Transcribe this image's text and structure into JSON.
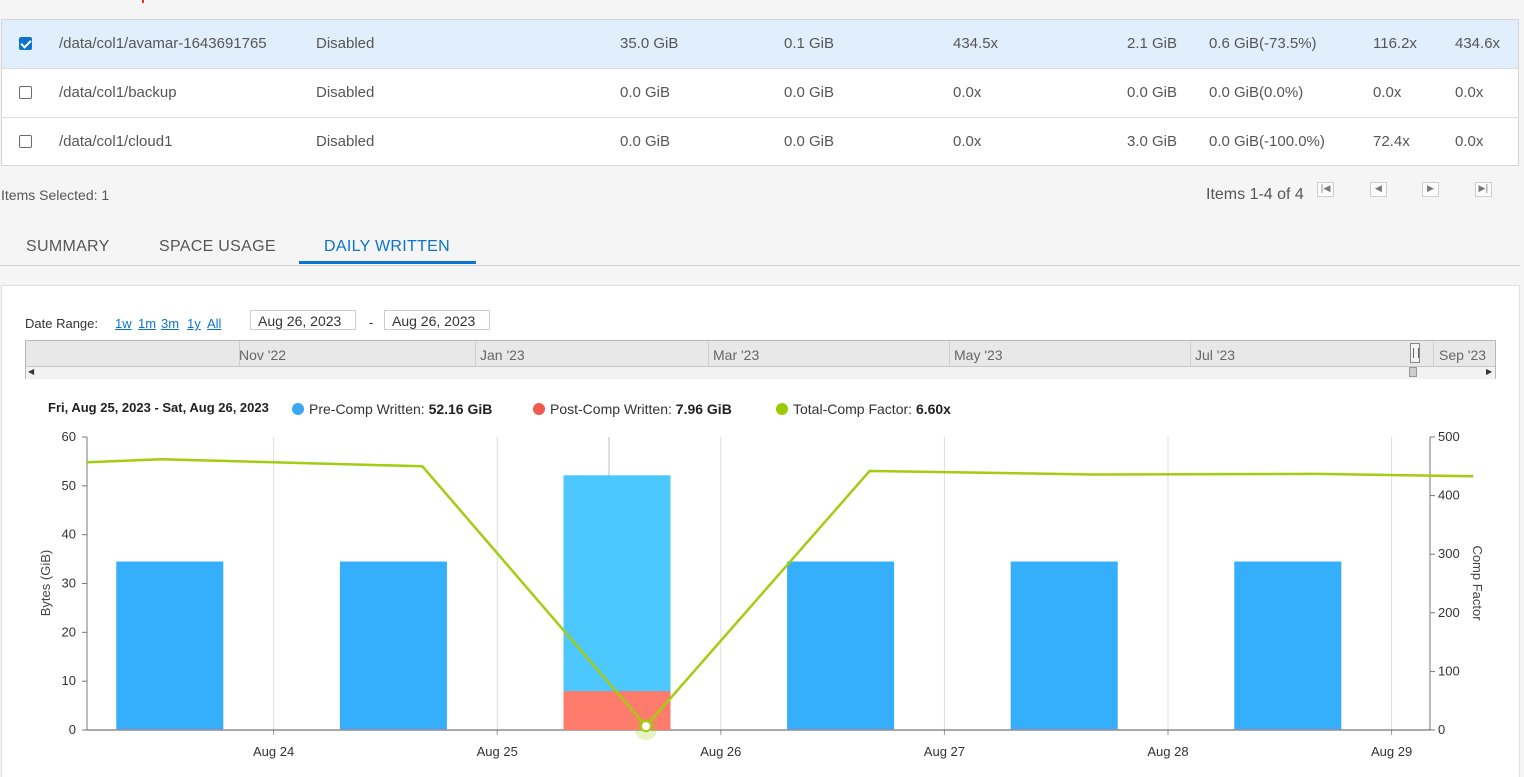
{
  "table": {
    "rows": [
      {
        "selected": true,
        "path": "/data/col1/avamar-1643691765",
        "status": "Disabled",
        "c3": "35.0 GiB",
        "c4": "0.1 GiB",
        "c5": "434.5x",
        "c6": "2.1 GiB",
        "c7": "0.6 GiB(-73.5%)",
        "c8": "116.2x",
        "c9": "434.6x"
      },
      {
        "selected": false,
        "path": "/data/col1/backup",
        "status": "Disabled",
        "c3": "0.0 GiB",
        "c4": "0.0 GiB",
        "c5": "0.0x",
        "c6": "0.0 GiB",
        "c7": "0.0 GiB(0.0%)",
        "c8": "0.0x",
        "c9": "0.0x"
      },
      {
        "selected": false,
        "path": "/data/col1/cloud1",
        "status": "Disabled",
        "c3": "0.0 GiB",
        "c4": "0.0 GiB",
        "c5": "0.0x",
        "c6": "3.0 GiB",
        "c7": "0.0 GiB(-100.0%)",
        "c8": "72.4x",
        "c9": "0.0x"
      }
    ]
  },
  "footer": {
    "items_selected": "Items Selected: 1",
    "items_count": "Items 1-4 of 4"
  },
  "tabs": [
    "SUMMARY",
    "SPACE USAGE",
    "DAILY WRITTEN"
  ],
  "active_tab": "DAILY WRITTEN",
  "date_range": {
    "label": "Date Range:",
    "presets": [
      "1w",
      "1m",
      "3m",
      "1y",
      "All"
    ],
    "from": "Aug 26, 2023",
    "separator": "-",
    "to": "Aug 26, 2023"
  },
  "navigator": {
    "months": [
      "Nov '22",
      "Jan '23",
      "Mar '23",
      "May '23",
      "Jul '23",
      "Sep '23"
    ]
  },
  "tooltip": {
    "period": "Fri, Aug 25, 2023 - Sat, Aug 26, 2023",
    "items": [
      {
        "label": "Pre-Comp Written:",
        "value": "52.16 GiB",
        "color": "#3aa8f5"
      },
      {
        "label": "Post-Comp Written:",
        "value": "7.96 GiB",
        "color": "#f0594d"
      },
      {
        "label": "Total-Comp Factor:",
        "value": "6.60x",
        "color": "#99cc00"
      }
    ]
  },
  "chart_data": {
    "type": "bar",
    "x_tick_labels": [
      "Aug 24",
      "Aug 25",
      "Aug 26",
      "Aug 27",
      "Aug 28",
      "Aug 29"
    ],
    "ylabel": "Bytes (GiB)",
    "y2label": "Comp Factor",
    "ylim": [
      0,
      60
    ],
    "y_ticks": [
      0,
      10,
      20,
      30,
      40,
      50,
      60
    ],
    "y2lim": [
      0,
      500
    ],
    "y2_ticks": [
      0,
      100,
      200,
      300,
      400,
      500
    ],
    "grid": true,
    "highlighted_index": 2,
    "series": [
      {
        "name": "Pre-Comp Written",
        "color": "#35aefc",
        "highlight_color": "#4dc8ff",
        "values": [
          34.5,
          34.5,
          52.16,
          34.5,
          34.5,
          34.5
        ]
      },
      {
        "name": "Post-Comp Written",
        "color": "#f46f62",
        "highlight_color": "#ff7b6b",
        "values": [
          0.1,
          0.1,
          7.96,
          0.1,
          0.1,
          0.1
        ]
      },
      {
        "name": "Total-Comp Factor",
        "color": "#a3cc12",
        "axis": "right",
        "points": [
          {
            "x": 0.0,
            "y": 457
          },
          {
            "x": 0.33,
            "y": 462
          },
          {
            "x": 1.5,
            "y": 450
          },
          {
            "x": 2.5,
            "y": 6.6
          },
          {
            "x": 3.5,
            "y": 442
          },
          {
            "x": 4.5,
            "y": 436
          },
          {
            "x": 5.5,
            "y": 437
          },
          {
            "x": 6.2,
            "y": 433
          }
        ]
      }
    ]
  }
}
